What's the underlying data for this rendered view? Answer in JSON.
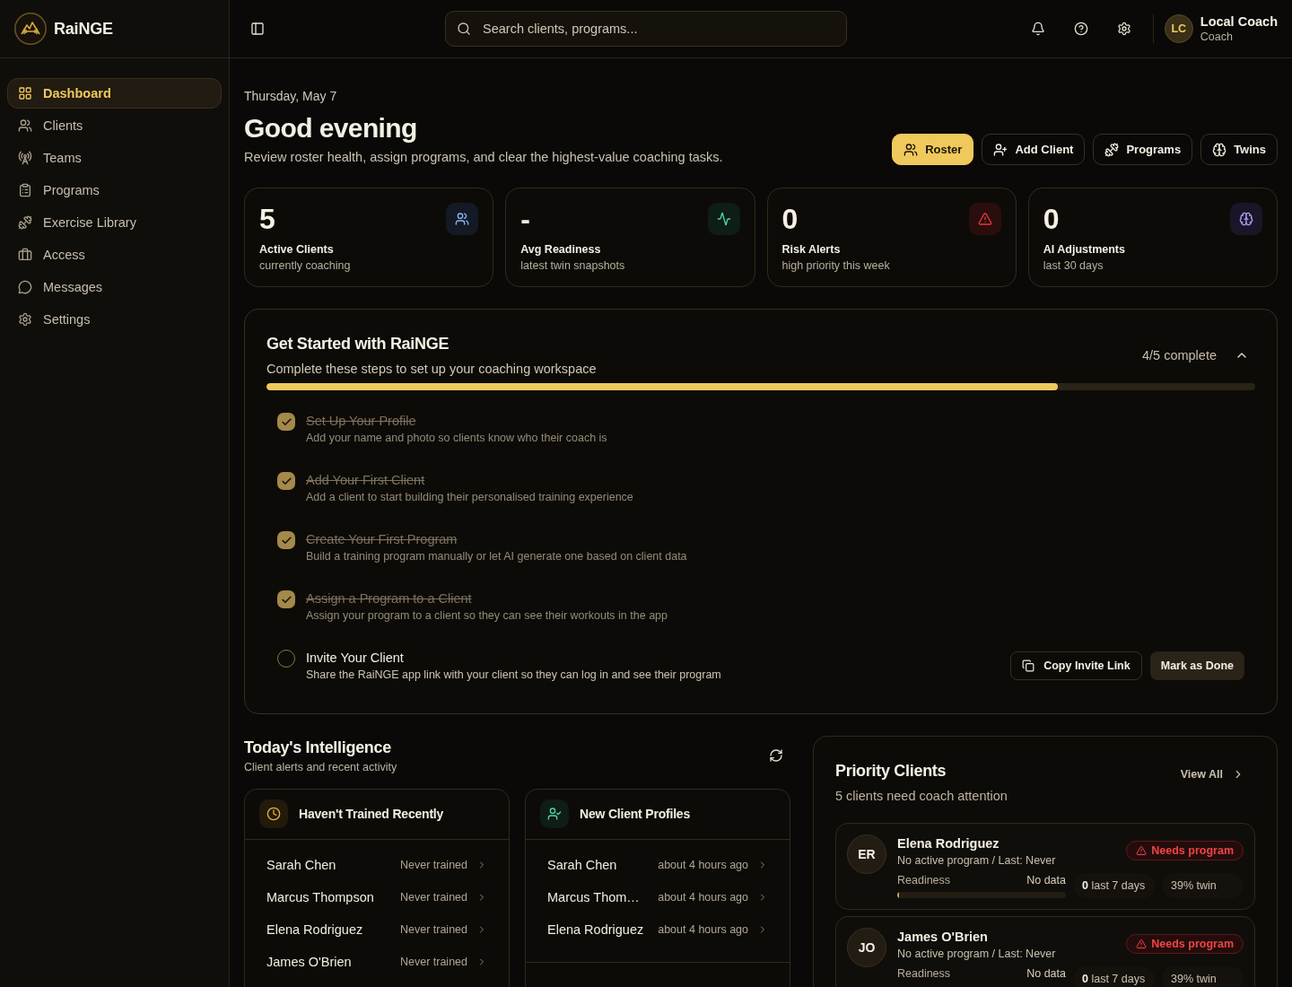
{
  "sidebar": {
    "brand": "RaiNGE",
    "items": [
      {
        "label": "Dashboard",
        "selected": true
      },
      {
        "label": "Clients",
        "selected": false
      },
      {
        "label": "Teams",
        "selected": false
      },
      {
        "label": "Programs",
        "selected": false
      },
      {
        "label": "Exercise Library",
        "selected": false
      },
      {
        "label": "Access",
        "selected": false
      },
      {
        "label": "Messages",
        "selected": false
      },
      {
        "label": "Settings",
        "selected": false
      }
    ]
  },
  "header": {
    "search": {
      "placeholder": "Search clients, programs..."
    },
    "user": {
      "initials": "LC",
      "name": "Local Coach",
      "role": "Coach"
    }
  },
  "greeting": {
    "date": "Thursday, May 7",
    "title": "Good evening",
    "subtitle": "Review roster health, assign programs, and clear the highest-value coaching tasks.",
    "buttons": [
      {
        "label": "Roster",
        "kind": "primary"
      },
      {
        "label": "Add Client",
        "kind": "outline"
      },
      {
        "label": "Programs",
        "kind": "outline"
      },
      {
        "label": "Twins",
        "kind": "outline"
      }
    ]
  },
  "stats": [
    {
      "kind": "clients",
      "value": "5",
      "label": "Active Clients",
      "caption": "currently coaching"
    },
    {
      "kind": "readiness",
      "value": "-",
      "label": "Avg Readiness",
      "caption": "latest twin snapshots"
    },
    {
      "kind": "risk",
      "value": "0",
      "label": "Risk Alerts",
      "caption": "high priority this week"
    },
    {
      "kind": "ai",
      "value": "0",
      "label": "AI Adjustments",
      "caption": "last 30 days"
    }
  ],
  "getting_started": {
    "title": "Get Started with RaiNGE",
    "subtitle": "Complete these steps to set up your coaching workspace",
    "progress": "4/5 complete",
    "expanded": true,
    "level": 0.8,
    "steps": [
      {
        "title": "Set Up Your Profile",
        "description": "Add your name and photo so clients know who their coach is",
        "checked": true
      },
      {
        "title": "Add Your First Client",
        "description": "Add a client to start building their personalised training experience",
        "checked": true
      },
      {
        "title": "Create Your First Program",
        "description": "Build a training program manually or let AI generate one based on client data",
        "checked": true
      },
      {
        "title": "Assign a Program to a Client",
        "description": "Assign your program to a client so they can see their workouts in the app",
        "checked": true
      },
      {
        "title": "Invite Your Client",
        "description": "Share the RaiNGE app link with your client so they can log in and see their program",
        "checked": false,
        "actions": [
          "Copy Invite Link",
          "Mark as Done"
        ]
      }
    ]
  },
  "intelligence": {
    "title": "Today's Intelligence",
    "subtitle": "Client alerts and recent activity",
    "cards": [
      {
        "kind": "inactive",
        "title": "Haven't Trained Recently",
        "rows": [
          {
            "name": "Sarah Chen",
            "status": "Never trained"
          },
          {
            "name": "Marcus Thompson",
            "status": "Never trained"
          },
          {
            "name": "Elena Rodriguez",
            "status": "Never trained"
          },
          {
            "name": "James O'Brien",
            "status": "Never trained"
          }
        ]
      },
      {
        "kind": "new",
        "title": "New Client Profiles",
        "rows": [
          {
            "name": "Sarah Chen",
            "status": "about 4 hours ago"
          },
          {
            "name": "Marcus Thom…",
            "status": "about 4 hours ago"
          },
          {
            "name": "Elena Rodriguez",
            "status": "about 4 hours ago"
          }
        ]
      }
    ]
  },
  "priority_clients": {
    "title": "Priority Clients",
    "link": "View All",
    "subtitle": "5 clients need coach attention",
    "clients": [
      {
        "initials": "ER",
        "name": "Elena Rodriguez",
        "detail": "No active program / Last: Never",
        "badge": "Needs program",
        "readiness": {
          "label": "Readiness",
          "value": "No data",
          "level": 0.01
        },
        "pills": [
          "**0** last 7 days",
          "39% twin"
        ]
      },
      {
        "initials": "JO",
        "name": "James O'Brien",
        "detail": "No active program / Last: Never",
        "badge": "Needs program",
        "readiness": {
          "label": "Readiness",
          "value": "No data"
        },
        "pills": [
          "**0** last 7 days",
          "39% twin"
        ]
      }
    ]
  }
}
